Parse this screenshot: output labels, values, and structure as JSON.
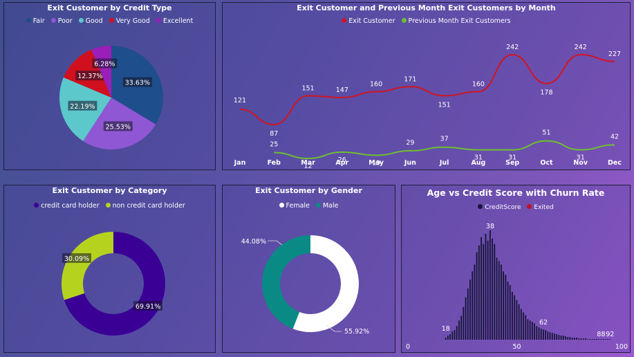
{
  "colors": {
    "fair": "#1f4e8c",
    "poor": "#8f57d3",
    "good": "#5cc8cc",
    "very_good": "#d0101e",
    "excellent": "#9a1fb8",
    "exit_line": "#d01522",
    "prev_line": "#6ec02f",
    "credit_holder": "#3a0096",
    "non_credit_holder": "#b5d31e",
    "female": "#ffffff",
    "male": "#0a8a85",
    "hist_bar": "#151536",
    "exited": "#c0102a"
  },
  "chart_data": [
    {
      "type": "pie",
      "title": "Exit Customer by Credit Type",
      "legend": [
        "Fair",
        "Poor",
        "Good",
        "Very Good",
        "Excellent"
      ],
      "slices": [
        {
          "name": "Fair",
          "value": 33.63,
          "label": "33.63%"
        },
        {
          "name": "Poor",
          "value": 25.53,
          "label": "25.53%"
        },
        {
          "name": "Good",
          "value": 22.19,
          "label": "22.19%"
        },
        {
          "name": "Very Good",
          "value": 12.37,
          "label": "12.37%"
        },
        {
          "name": "Excellent",
          "value": 6.28,
          "label": "6.28%"
        }
      ]
    },
    {
      "type": "line",
      "title": "Exit Customer and Previous Month Exit Customers by Month",
      "categories": [
        "Jan",
        "Feb",
        "Mar",
        "Apr",
        "May",
        "Jun",
        "Jul",
        "Aug",
        "Sep",
        "Oct",
        "Nov",
        "Dec"
      ],
      "series": [
        {
          "name": "Exit Customer",
          "values": [
            121,
            87,
            151,
            147,
            160,
            171,
            151,
            160,
            242,
            178,
            242,
            227
          ]
        },
        {
          "name": "Previous Month Exit Customers",
          "values": [
            null,
            25,
            12,
            26,
            19,
            29,
            37,
            31,
            31,
            51,
            31,
            42
          ]
        }
      ]
    },
    {
      "type": "pie",
      "title": "Exit Customer by Category",
      "legend": [
        "credit card holder",
        "non credit card holder"
      ],
      "slices": [
        {
          "name": "credit card holder",
          "value": 69.91,
          "label": "69.91%"
        },
        {
          "name": "non credit card holder",
          "value": 30.09,
          "label": "30.09%"
        }
      ]
    },
    {
      "type": "pie",
      "title": "Exit Customer by Gender",
      "legend": [
        "Female",
        "Male"
      ],
      "slices": [
        {
          "name": "Female",
          "value": 55.92,
          "label": "55.92%"
        },
        {
          "name": "Male",
          "value": 44.08,
          "label": "44.08%"
        }
      ]
    },
    {
      "type": "bar",
      "title": "Age vs Credit Score with Churn Rate",
      "legend": [
        "CreditScore",
        "Exited"
      ],
      "x_ticks": [
        "0",
        "50",
        "100"
      ],
      "xlim": [
        0,
        100
      ],
      "annotations": [
        "18",
        "38",
        "62",
        "88",
        "92"
      ],
      "x": [
        18,
        19,
        20,
        21,
        22,
        23,
        24,
        25,
        26,
        27,
        28,
        29,
        30,
        31,
        32,
        33,
        34,
        35,
        36,
        37,
        38,
        39,
        40,
        41,
        42,
        43,
        44,
        45,
        46,
        47,
        48,
        49,
        50,
        51,
        52,
        53,
        54,
        55,
        56,
        57,
        58,
        59,
        60,
        61,
        62,
        63,
        64,
        65,
        66,
        67,
        68,
        69,
        70,
        71,
        72,
        73,
        74,
        75,
        76,
        77,
        78,
        79,
        80,
        81,
        82,
        83,
        84,
        85,
        86,
        87,
        88,
        89,
        90,
        91,
        92
      ],
      "values": [
        3,
        6,
        8,
        12,
        14,
        20,
        28,
        35,
        48,
        62,
        75,
        88,
        100,
        110,
        128,
        138,
        150,
        140,
        155,
        145,
        160,
        148,
        140,
        120,
        115,
        110,
        100,
        95,
        85,
        80,
        70,
        65,
        58,
        52,
        45,
        40,
        36,
        30,
        28,
        26,
        24,
        20,
        18,
        16,
        15,
        14,
        12,
        11,
        10,
        9,
        8,
        7,
        6,
        6,
        5,
        4,
        4,
        3,
        3,
        3,
        2,
        2,
        2,
        2,
        1,
        1,
        1,
        1,
        1,
        1,
        1,
        1,
        1,
        1,
        1
      ]
    }
  ]
}
